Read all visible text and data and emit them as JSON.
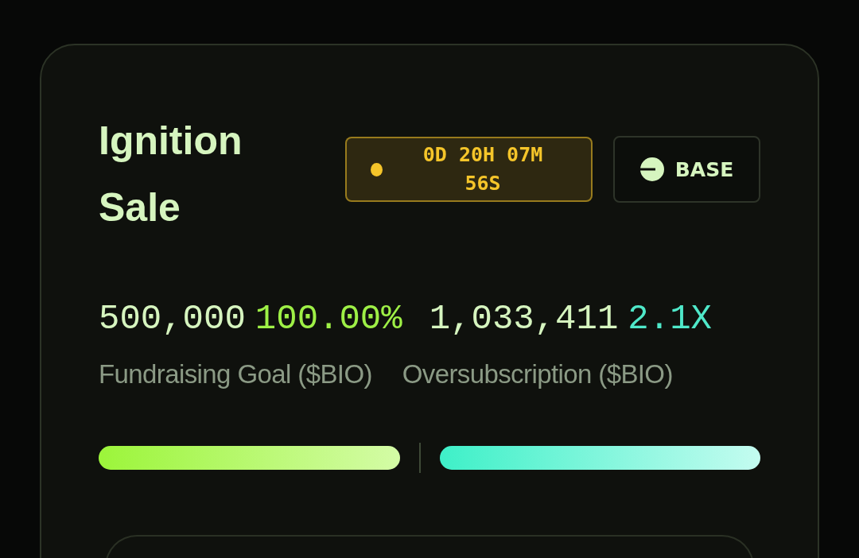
{
  "title": "Ignition Sale",
  "timer": {
    "text": "0D 20H 07M 56S",
    "color": "#f5c52a"
  },
  "network": {
    "label": "BASE"
  },
  "stats": [
    {
      "amount": "500,000",
      "figure": "100.00%",
      "label": "Fundraising Goal ($BIO)",
      "kind": "percent"
    },
    {
      "amount": "1,033,411",
      "figure": "2.1X",
      "label": "Oversubscription ($BIO)",
      "kind": "multiple"
    }
  ],
  "bars": [
    {
      "kind": "goal",
      "level": 1
    },
    {
      "kind": "oversubscription",
      "level": 1
    }
  ]
}
